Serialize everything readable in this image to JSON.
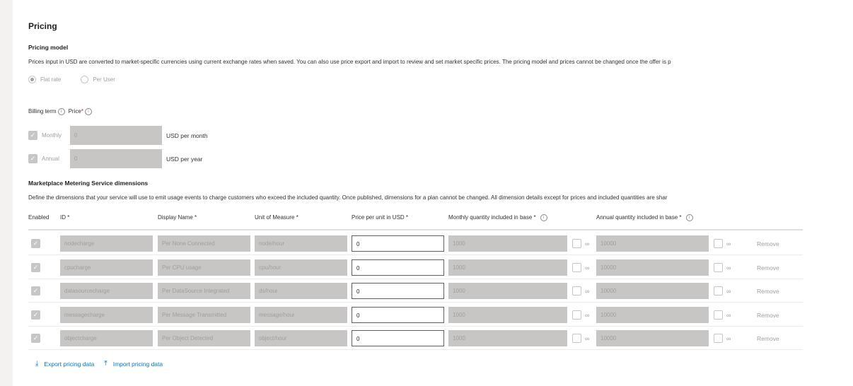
{
  "pricing": {
    "title": "Pricing",
    "model_title": "Pricing model",
    "model_desc": "Prices input in USD are converted to market-specific currencies using current exchange rates when saved. You can also use price export and import to review and set market specific prices. The pricing model and prices cannot be changed once the offer is p",
    "radios": [
      {
        "label": "Flat rate",
        "selected": true
      },
      {
        "label": "Per User",
        "selected": false
      }
    ],
    "billing_term_label": "Billing term",
    "price_label": "Price",
    "required_mark": "*",
    "info_glyph": "i",
    "billing": [
      {
        "label": "Monthly",
        "value": "0",
        "unit": "USD per month",
        "checked": true
      },
      {
        "label": "Annual",
        "value": "0",
        "unit": "USD per year",
        "checked": true
      }
    ]
  },
  "metering": {
    "title": "Marketplace Metering Service dimensions",
    "desc": "Define the dimensions that your service will use to emit usage events to charge customers who exceed the included quantity. Once published, dimensions for a plan cannot be changed. All dimension details except for prices and included quantities are shar",
    "columns": {
      "enabled": "Enabled",
      "id": "ID *",
      "display_name": "Display Name *",
      "unit": "Unit of Measure *",
      "price": "Price per unit in USD *",
      "monthly": "Monthly quantity included in base *",
      "annual": "Annual quantity included in base *"
    },
    "infinity_glyph": "∞",
    "remove_label": "Remove",
    "rows": [
      {
        "id": "nodecharge",
        "display_name": "Per None Connected",
        "unit": "node/hour",
        "price": "0",
        "monthly": "1000",
        "annual": "10000"
      },
      {
        "id": "cpucharge",
        "display_name": "Per CPU usage",
        "unit": "cpu/hour",
        "price": "0",
        "monthly": "1000",
        "annual": "10000"
      },
      {
        "id": "datasourcecharge",
        "display_name": "Per DataSource Integrated",
        "unit": "ds/hour",
        "price": "0",
        "monthly": "1000",
        "annual": "10000"
      },
      {
        "id": "messagecharge",
        "display_name": "Per Message Transmitted",
        "unit": "message/hour",
        "price": "0",
        "monthly": "1000",
        "annual": "10000"
      },
      {
        "id": "objectcharge",
        "display_name": "Per Object Detected",
        "unit": "object/hour",
        "price": "0",
        "monthly": "1000",
        "annual": "10000"
      }
    ]
  },
  "actions": {
    "export_label": "Export pricing data",
    "import_label": "Import pricing data"
  },
  "colors": {
    "link": "#0078d4",
    "disabled_fill": "#c8c6c4",
    "required": "#a4262c"
  }
}
